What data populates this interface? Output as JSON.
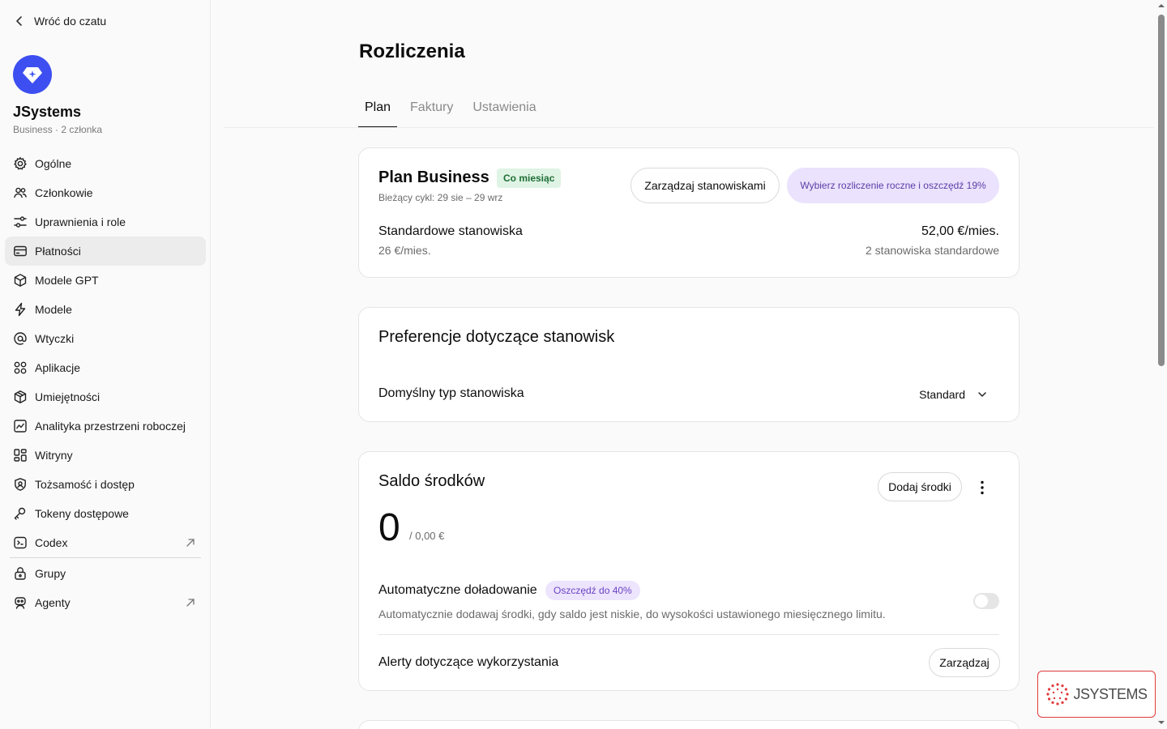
{
  "back_label": "Wróć do czatu",
  "workspace": {
    "name": "JSystems",
    "subtitle": "Business · 2 członka"
  },
  "nav": [
    {
      "label": "Ogólne",
      "icon": "gear-icon"
    },
    {
      "label": "Członkowie",
      "icon": "users-icon"
    },
    {
      "label": "Uprawnienia i role",
      "icon": "sliders-icon"
    },
    {
      "label": "Płatności",
      "icon": "credit-card-icon",
      "active": true
    },
    {
      "label": "Modele GPT",
      "icon": "cube-icon"
    },
    {
      "label": "Modele",
      "icon": "bolt-icon"
    },
    {
      "label": "Wtyczki",
      "icon": "at-icon"
    },
    {
      "label": "Aplikacje",
      "icon": "apps-icon"
    },
    {
      "label": "Umiejętności",
      "icon": "package-icon"
    },
    {
      "label": "Analityka przestrzeni roboczej",
      "icon": "chart-icon"
    },
    {
      "label": "Witryny",
      "icon": "grid-icon"
    },
    {
      "label": "Tożsamość i dostęp",
      "icon": "shield-icon"
    },
    {
      "label": "Tokeny dostępowe",
      "icon": "key-icon"
    },
    {
      "label": "Codex",
      "icon": "codex-icon",
      "external": true
    },
    {
      "label": "Grupy",
      "icon": "lock-icon"
    },
    {
      "label": "Agenty",
      "icon": "robot-icon",
      "external": true
    }
  ],
  "page_title": "Rozliczenia",
  "tabs": [
    "Plan",
    "Faktury",
    "Ustawienia"
  ],
  "plan": {
    "title": "Plan Business",
    "badge": "Co miesiąc",
    "cycle": "Bieżący cykl: 29 sie – 29 wrz",
    "manage_seats": "Zarządzaj stanowiskami",
    "annual_cta": "Wybierz rozliczenie roczne i oszczędź 19%",
    "seat_label": "Standardowe stanowiska",
    "seat_price": "26 €/mies.",
    "total": "52,00 €/mies.",
    "total_sub": "2 stanowiska standardowe"
  },
  "prefs": {
    "title": "Preferencje dotyczące stanowisk",
    "default_label": "Domyślny typ stanowiska",
    "default_value": "Standard"
  },
  "balance": {
    "title": "Saldo środków",
    "add_button": "Dodaj środki",
    "value": "0",
    "value_sub": "/ 0,00 €",
    "auto_label": "Automatyczne doładowanie",
    "auto_badge": "Oszczędź do 40%",
    "auto_desc": "Automatycznie dodawaj środki, gdy saldo jest niskie, do wysokości ustawionego miesięcznego limitu.",
    "alerts_label": "Alerty dotyczące wykorzystania",
    "alerts_button": "Zarządzaj"
  },
  "watermark": {
    "brand": "JSYSTEMS"
  },
  "colors": {
    "accent": "#3d4ff0",
    "cta_bg": "#ebe2fd",
    "badge_green": "#dff4e4"
  }
}
